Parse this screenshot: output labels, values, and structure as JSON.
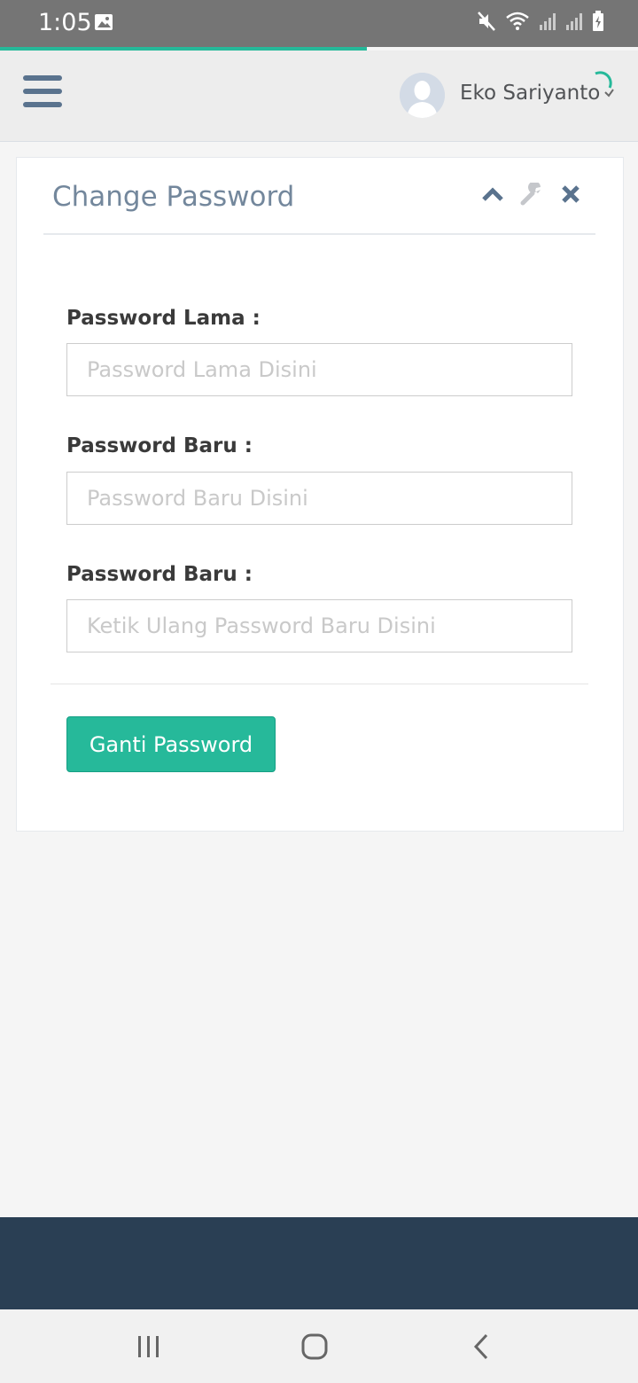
{
  "status_bar": {
    "time": "1:05",
    "left_icons": [
      "image-icon"
    ],
    "right_icons": [
      "mute-icon",
      "wifi-icon",
      "signal-icon",
      "signal-icon",
      "battery-charging-icon"
    ]
  },
  "page_load": {
    "progress": 0.575
  },
  "header": {
    "menu_icon": "hamburger-icon",
    "user_name": "Eko Sariyanto"
  },
  "panel": {
    "title": "Change Password",
    "tools": [
      "chevron-up-icon",
      "wrench-icon",
      "close-icon"
    ]
  },
  "form": {
    "fields": [
      {
        "label": "Password Lama :",
        "placeholder": "Password Lama Disini",
        "value": ""
      },
      {
        "label": "Password Baru :",
        "placeholder": "Password Baru Disini",
        "value": ""
      },
      {
        "label": "Password Baru :",
        "placeholder": "Ketik Ulang Password Baru Disini",
        "value": ""
      }
    ],
    "submit_label": "Ganti Password"
  },
  "colors": {
    "accent": "#26b99a",
    "footer": "#2a3f54",
    "header_bg": "#ededed",
    "status_bar": "#757575",
    "title_text": "#73879c",
    "icon": "#5a738e"
  },
  "android_nav": [
    "recents-icon",
    "home-icon",
    "back-icon"
  ]
}
